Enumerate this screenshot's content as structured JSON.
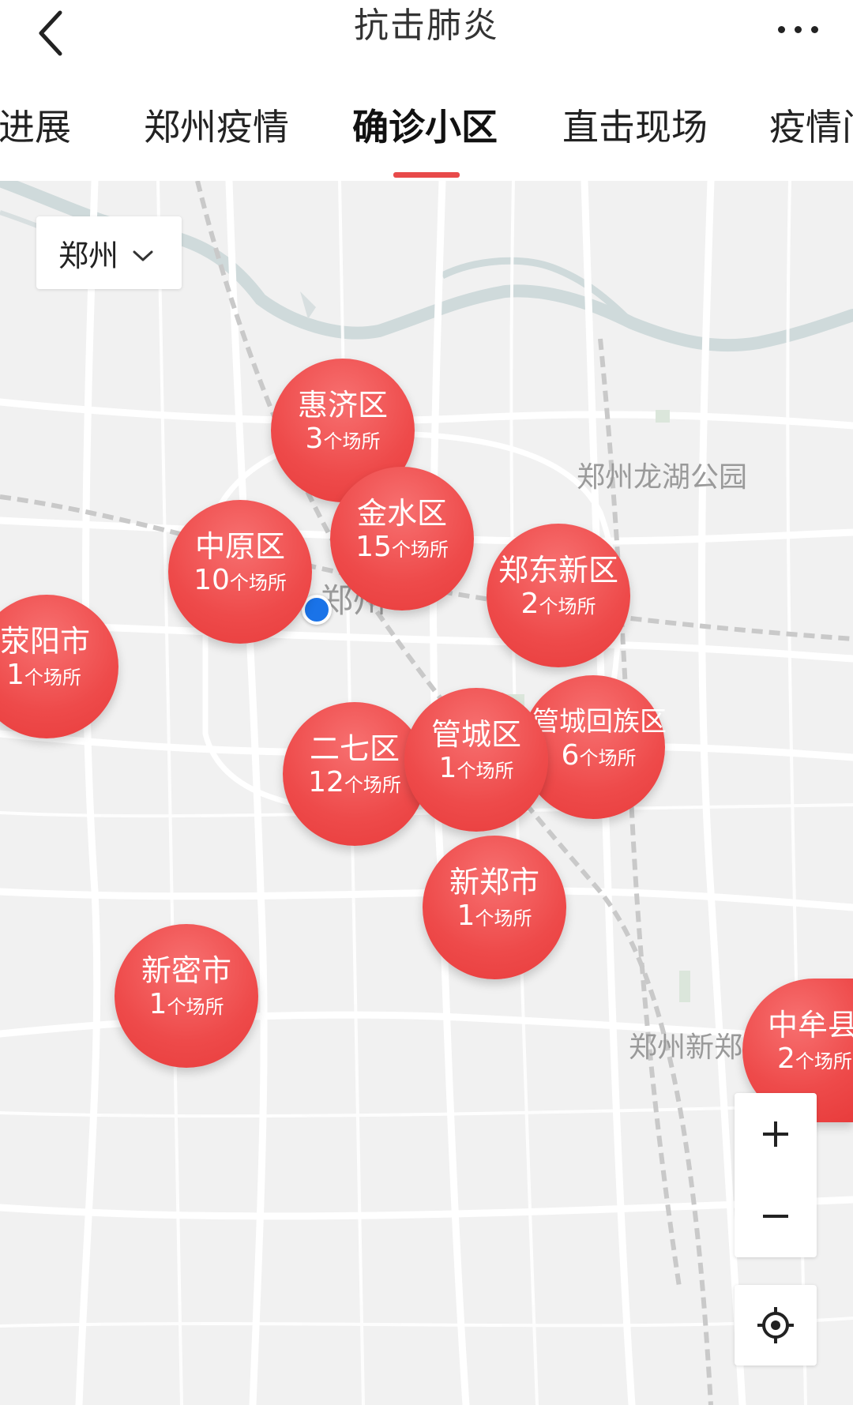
{
  "header": {
    "title": "抗击肺炎",
    "back_icon": "back-arrow-icon",
    "more_icon": "more-dots-icon"
  },
  "tabs": [
    {
      "label": "新进展",
      "visible_text": "新进展"
    },
    {
      "label": "郑州疫情"
    },
    {
      "label": "确诊小区",
      "active": true
    },
    {
      "label": "直击现场"
    },
    {
      "label": "疫情问",
      "visible_text": "疫情问"
    }
  ],
  "accent_color": "#e84a4a",
  "city_select": {
    "value": "郑州"
  },
  "map_labels": {
    "city": "郑州",
    "park": "郑州龙湖公园",
    "airport": "郑州新郑国际机场"
  },
  "bubble_unit": "个场所",
  "districts": [
    {
      "name": "惠济区",
      "count": "3"
    },
    {
      "name": "金水区",
      "count": "15"
    },
    {
      "name": "中原区",
      "count": "10"
    },
    {
      "name": "郑东新区",
      "count": "2"
    },
    {
      "name": "荥阳市",
      "count": "1"
    },
    {
      "name": "管城回族区",
      "count": "6"
    },
    {
      "name": "二七区",
      "count": "12"
    },
    {
      "name": "管城区",
      "count": "1"
    },
    {
      "name": "新郑市",
      "count": "1"
    },
    {
      "name": "新密市",
      "count": "1"
    },
    {
      "name": "中牟县",
      "count": "2"
    }
  ],
  "controls": {
    "zoom_in_icon": "plus-icon",
    "zoom_out_icon": "minus-icon",
    "locate_icon": "locate-icon"
  }
}
